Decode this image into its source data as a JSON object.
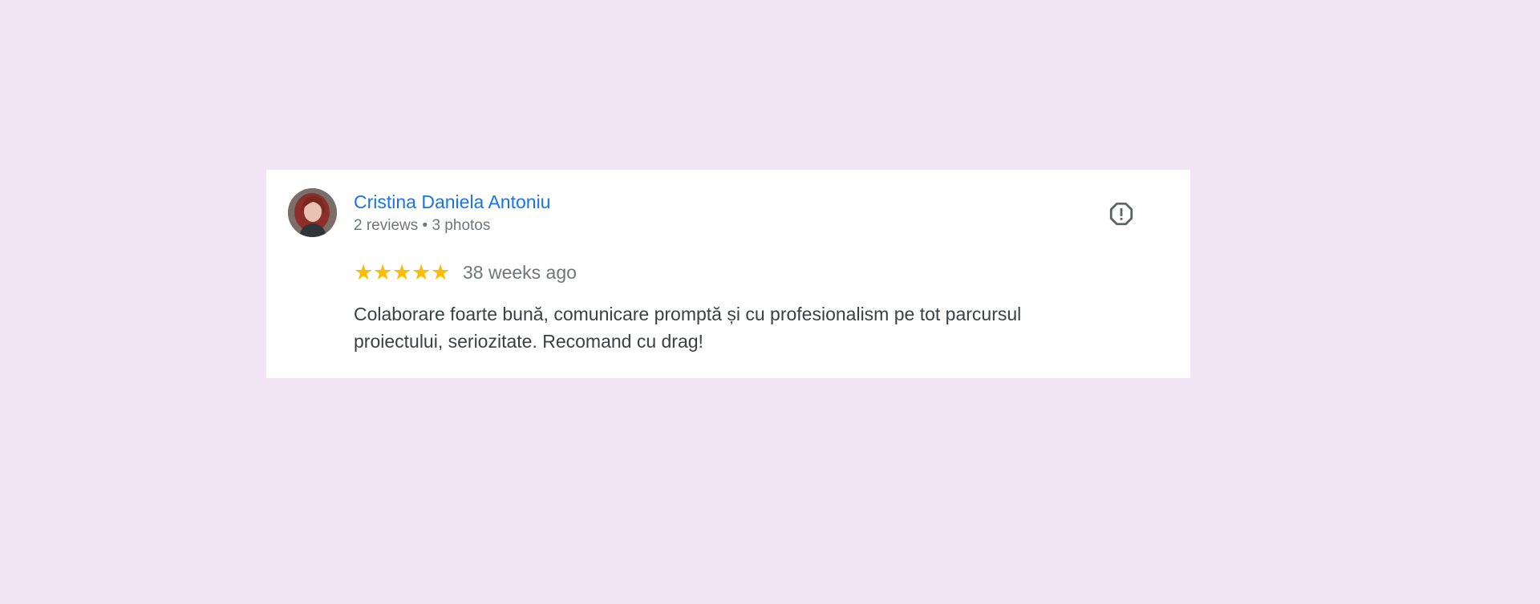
{
  "review": {
    "author_name": "Cristina Daniela Antoniu",
    "author_meta": "2 reviews • 3 photos",
    "rating": 5,
    "stars": [
      "★",
      "★",
      "★",
      "★",
      "★"
    ],
    "time_ago": "38 weeks ago",
    "text": "Colaborare foarte bună, comunicare promptă și cu profesionalism pe tot parcursul proiectului, seriozitate. Recomand cu drag!"
  },
  "icons": {
    "avatar": "avatar-photo",
    "report": "report-flag-icon",
    "star": "star-icon"
  },
  "colors": {
    "page_background": "#f0e4f5",
    "card_background": "#ffffff",
    "author_name": "#1a73e8",
    "star": "#fbbc04",
    "secondary_text": "#70757a",
    "body_text": "#3c4043"
  }
}
